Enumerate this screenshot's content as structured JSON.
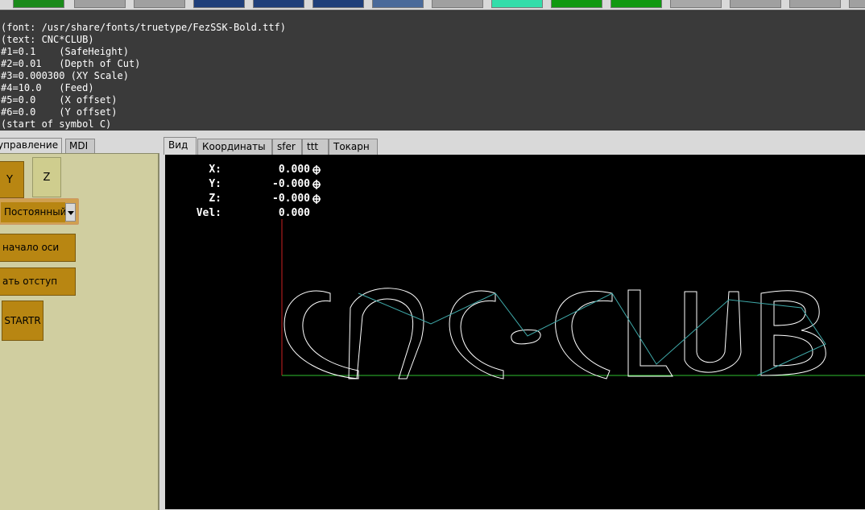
{
  "toolbar": {
    "buttons": [
      {
        "color": "#1a8a1a"
      },
      {
        "color": "#a0a0a0"
      },
      {
        "color": "#a0a0a0"
      },
      {
        "color": "#1f3f7a"
      },
      {
        "color": "#1f3f7a"
      },
      {
        "color": "#1f3f7a"
      },
      {
        "color": "#4a6a9a"
      },
      {
        "color": "#a0a0a0"
      },
      {
        "color": "#33ddaa"
      },
      {
        "color": "#119911"
      },
      {
        "color": "#119911"
      },
      {
        "color": "#a8a8a8"
      },
      {
        "color": "#a0a0a0"
      },
      {
        "color": "#a0a0a0"
      },
      {
        "color": "#a0a0a0"
      }
    ]
  },
  "gcode": {
    "lines": [
      "(font: /usr/share/fonts/truetype/FezSSK-Bold.ttf)",
      "(text: CNC*CLUB)",
      "#1=0.1    (SafeHeight)",
      "#2=0.01   (Depth of Cut)",
      "#3=0.000300 (XY Scale)",
      "#4=10.0   (Feed)",
      "#5=0.0    (X offset)",
      "#6=0.0    (Y offset)",
      "(start of symbol C)"
    ]
  },
  "left": {
    "tabs": [
      "управление",
      "MDI"
    ],
    "axis_y": "Y",
    "axis_z": "Z",
    "mode_value": "Постоянный",
    "home_label": "начало оси",
    "offset_label": "ать отступ",
    "startr_label": "STARTR"
  },
  "right": {
    "tabs": [
      "Вид",
      "Координаты",
      "sfer",
      "ttt",
      "Токарн"
    ]
  },
  "dro": {
    "rows": [
      {
        "label": "X:",
        "value": "0.000"
      },
      {
        "label": "Y:",
        "value": "-0.000"
      },
      {
        "label": "Z:",
        "value": "-0.000"
      },
      {
        "label": "Vel:",
        "value": "0.000"
      }
    ]
  },
  "colors": {
    "path": "#ffffff",
    "rapid": "#3fa9a9",
    "axis_x": "#2fbf2f",
    "axis_y": "#cc2222"
  }
}
